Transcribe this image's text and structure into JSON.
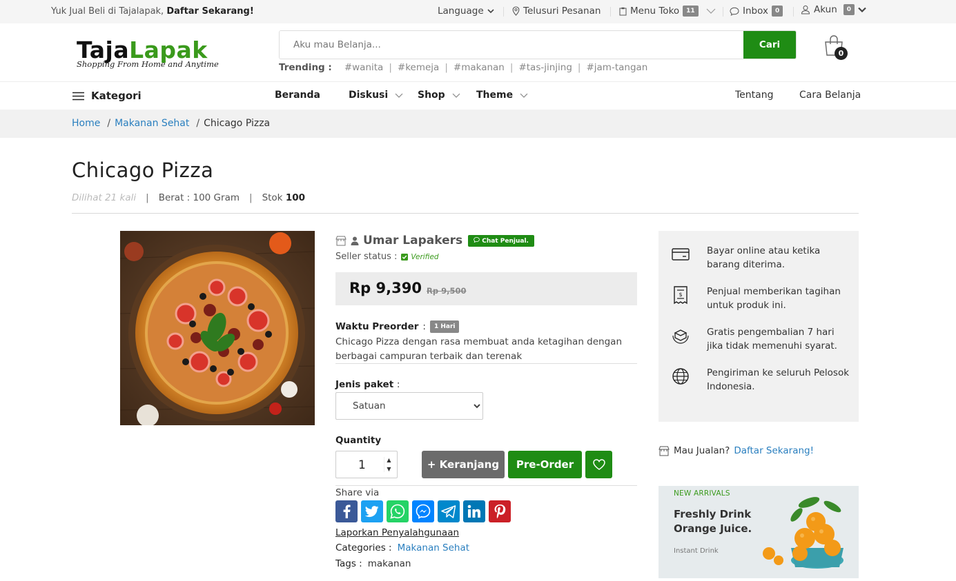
{
  "topbar": {
    "promo_text": "Yuk Jual Beli di Tajalapak,",
    "promo_link": "Daftar Sekarang!",
    "language": "Language",
    "track_order": "Telusuri Pesanan",
    "menu_toko": "Menu Toko",
    "menu_toko_count": "11",
    "inbox": "Inbox",
    "inbox_count": "0",
    "account": "Akun",
    "account_count": "0"
  },
  "header": {
    "logo_a": "Taja",
    "logo_b": "Lapak",
    "logo_tagline": "Shopping From Home and Anytime",
    "search_placeholder": "Aku mau Belanja...",
    "search_button": "Cari",
    "trending_label": "Trending :",
    "trending": [
      "#wanita",
      "#kemeja",
      "#makanan",
      "#tas-jinjing",
      "#jam-tangan"
    ],
    "cart_count": "0"
  },
  "nav": {
    "kategori": "Kategori",
    "items": [
      "Beranda",
      "Diskusi",
      "Shop",
      "Theme"
    ],
    "right_items": [
      "Tentang",
      "Cara Belanja"
    ]
  },
  "breadcrumb": [
    "Home",
    "Makanan Sehat",
    "Chicago Pizza"
  ],
  "product": {
    "title": "Chicago Pizza",
    "views": "Dilihat 21 kali",
    "weight": "Berat : 100 Gram",
    "stock_label": "Stok",
    "stock_value": "100",
    "seller_name": "Umar Lapakers",
    "chat_button": "Chat Penjual.",
    "seller_status_label": "Seller status :",
    "seller_status": "Verified",
    "price": "Rp 9,390",
    "old_price": "Rp 9,500",
    "preorder_label": "Waktu Preorder",
    "preorder_value": "1 Hari",
    "description": "Chicago Pizza dengan rasa membuat anda ketagihan dengan berbagai campuran terbaik dan terenak",
    "package_label": "Jenis paket",
    "package_selected": "Satuan",
    "quantity_label": "Quantity",
    "quantity": "1",
    "add_cart_button": "+ Keranjang",
    "preorder_button": "Pre-Order",
    "share_label": "Share via",
    "report_link": "Laporkan Penyalahgunaan",
    "categories_label": "Categories :",
    "category": "Makanan Sehat",
    "tags_label": "Tags :",
    "tag": "makanan"
  },
  "benefits": [
    {
      "icon": "card-icon",
      "text": "Bayar online atau ketika barang diterima."
    },
    {
      "icon": "invoice-icon",
      "text": "Penjual memberikan tagihan untuk produk ini."
    },
    {
      "icon": "return-box-icon",
      "text": "Gratis pengembalian 7 hari jika tidak memenuhi syarat."
    },
    {
      "icon": "globe-icon",
      "text": "Pengiriman ke seluruh Pelosok Indonesia."
    }
  ],
  "seller_cta": {
    "text": "Mau Jualan?",
    "link": "Daftar Sekarang!"
  },
  "banner": {
    "eyebrow": "NEW ARRIVALS",
    "headline": "Freshly Drink Orange Juice.",
    "sub": "Instant Drink"
  },
  "colors": {
    "brand_green": "#1f8c14",
    "link_blue": "#2a7fbf",
    "facebook": "#3b5998",
    "twitter": "#1da1f2",
    "whatsapp": "#25d366",
    "messenger": "#0084ff",
    "telegram": "#0088cc",
    "linkedin": "#0077b5",
    "pinterest": "#cb2027"
  }
}
